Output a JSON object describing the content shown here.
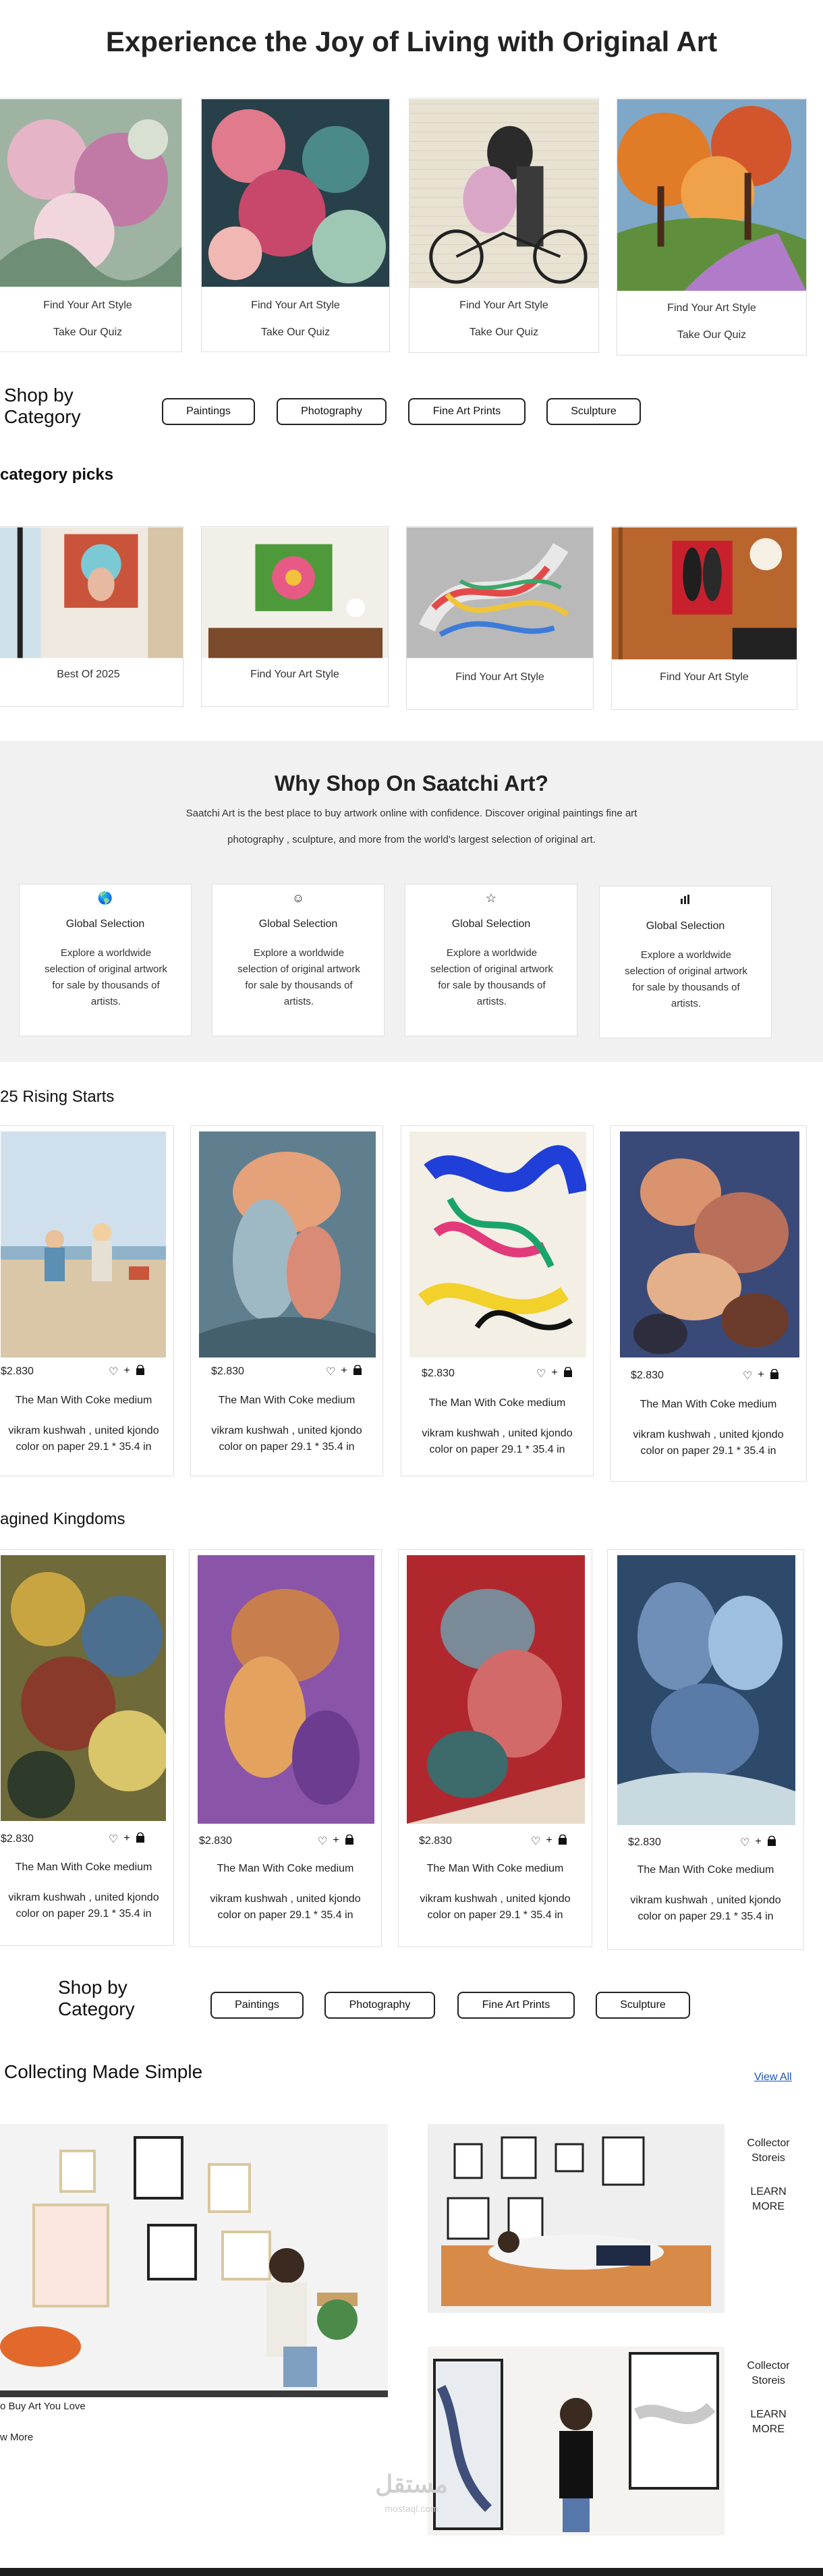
{
  "hero": {
    "title": "Experience the Joy of Living with Original Art"
  },
  "quiz_cards": [
    {
      "line1": "Find Your Art Style",
      "line2": "Take Our Quiz"
    },
    {
      "line1": "Find Your Art Style",
      "line2": "Take Our Quiz"
    },
    {
      "line1": "Find Your Art Style",
      "line2": "Take Our Quiz"
    },
    {
      "line1": "Find Your Art Style",
      "line2": "Take Our Quiz"
    }
  ],
  "shop_category_1": {
    "heading": "Shop by Category",
    "pills": [
      "Paintings",
      "Photography",
      "Fine Art Prints",
      "Sculpture"
    ]
  },
  "category_picks": {
    "title": "category picks",
    "cards": [
      "Best Of 2025",
      "Find Your Art Style",
      "Find Your Art Style",
      "Find Your Art Style"
    ]
  },
  "why": {
    "title": "Why Shop On Saatchi Art?",
    "desc": "Saatchi Art is the best place to buy artwork online with confidence. Discover original paintings fine art photography , sculpture, and more from the world's largest selection of original art.",
    "cards": [
      {
        "icon": "globe-icon",
        "title": "Global Selection",
        "text": "Explore a worldwide selection of original artwork for sale by thousands of artists."
      },
      {
        "icon": "smiley-icon",
        "title": "Global Selection",
        "text": "Explore a worldwide selection of original artwork for sale by thousands of artists."
      },
      {
        "icon": "star-icon",
        "title": "Global Selection",
        "text": "Explore a worldwide selection of original artwork for sale by thousands of artists."
      },
      {
        "icon": "bar-chart-icon",
        "title": "Global Selection",
        "text": "Explore a worldwide selection of original artwork for sale by thousands of artists."
      }
    ]
  },
  "rising": {
    "title": "25 Rising Starts",
    "products": [
      {
        "price": "$2.830",
        "name": "The Man With Coke medium",
        "meta": "vikram kushwah , united kjondo color on paper 29.1 * 35.4 in"
      },
      {
        "price": "$2.830",
        "name": "The Man With Coke medium",
        "meta": "vikram kushwah , united kjondo color on paper 29.1 * 35.4 in"
      },
      {
        "price": "$2.830",
        "name": "The Man With Coke medium",
        "meta": "vikram kushwah , united kjondo color on paper 29.1 * 35.4 in"
      },
      {
        "price": "$2.830",
        "name": "The Man With Coke medium",
        "meta": "vikram kushwah , united kjondo color on paper 29.1 * 35.4 in"
      }
    ]
  },
  "kingdoms": {
    "title": "agined Kingdoms",
    "products": [
      {
        "price": "$2.830",
        "name": "The Man With Coke medium",
        "meta": "vikram kushwah , united kjondo color on paper 29.1 * 35.4 in"
      },
      {
        "price": "$2.830",
        "name": "The Man With Coke medium",
        "meta": "vikram kushwah , united kjondo color on paper 29.1 * 35.4 in"
      },
      {
        "price": "$2.830",
        "name": "The Man With Coke medium",
        "meta": "vikram kushwah , united kjondo color on paper 29.1 * 35.4 in"
      },
      {
        "price": "$2.830",
        "name": "The Man With Coke medium",
        "meta": "vikram kushwah , united kjondo color on paper 29.1 * 35.4 in"
      }
    ]
  },
  "shop_category_2": {
    "heading": "Shop by Category",
    "pills": [
      "Paintings",
      "Photography",
      "Fine Art Prints",
      "Sculpture"
    ]
  },
  "collecting": {
    "title": "Collecting Made Simple",
    "view_all": "View All",
    "main_caption": "o Buy Art You Love",
    "main_link": "w More",
    "stories": [
      {
        "label": "Collector Storeis",
        "link": "LEARN MORE"
      },
      {
        "label": "Collector Storeis",
        "link": "LEARN MORE"
      }
    ]
  },
  "watermark": {
    "text": "مستقل",
    "sub": "mostaql.com"
  },
  "actions": {
    "heart": "♡",
    "plus": "+",
    "bag": "🛍"
  }
}
